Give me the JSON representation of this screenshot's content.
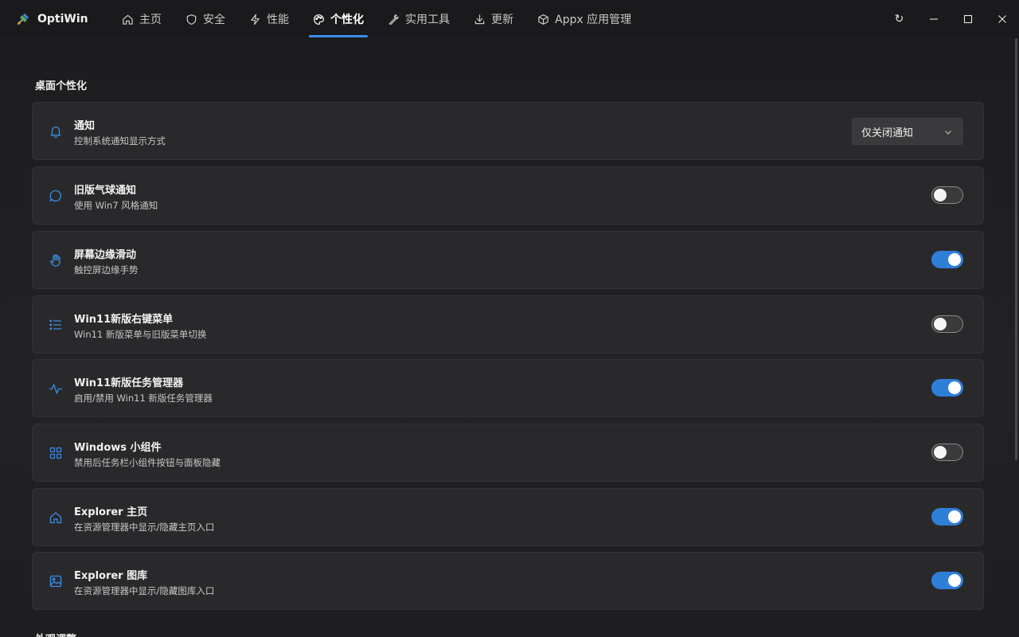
{
  "app": {
    "title": "OptiWin"
  },
  "tabs": [
    {
      "label": "主页",
      "icon": "home-icon"
    },
    {
      "label": "安全",
      "icon": "shield-icon"
    },
    {
      "label": "性能",
      "icon": "lightning-icon"
    },
    {
      "label": "个性化",
      "icon": "palette-icon",
      "active": true
    },
    {
      "label": "实用工具",
      "icon": "wrench-icon"
    },
    {
      "label": "更新",
      "icon": "download-icon"
    },
    {
      "label": "Appx 应用管理",
      "icon": "package-icon"
    }
  ],
  "window_controls": {
    "refresh": "↻"
  },
  "section": {
    "title": "桌面个性化",
    "next_title": "外观调整"
  },
  "settings": [
    {
      "title": "通知",
      "desc": "控制系统通知显示方式",
      "icon": "bell-icon",
      "control": "dropdown",
      "value": "仅关闭通知"
    },
    {
      "title": "旧版气球通知",
      "desc": "使用 Win7 风格通知",
      "icon": "chat-bubble-icon",
      "control": "toggle",
      "on": false
    },
    {
      "title": "屏幕边缘滑动",
      "desc": "触控屏边缘手势",
      "icon": "hand-icon",
      "control": "toggle",
      "on": true
    },
    {
      "title": "Win11新版右键菜单",
      "desc": "Win11 新版菜单与旧版菜单切换",
      "icon": "list-icon",
      "control": "toggle",
      "on": false
    },
    {
      "title": "Win11新版任务管理器",
      "desc": "启用/禁用 Win11 新版任务管理器",
      "icon": "activity-icon",
      "control": "toggle",
      "on": true
    },
    {
      "title": "Windows 小组件",
      "desc": "禁用后任务栏小组件按钮与面板隐藏",
      "icon": "grid-icon",
      "control": "toggle",
      "on": false
    },
    {
      "title": "Explorer 主页",
      "desc": "在资源管理器中显示/隐藏主页入口",
      "icon": "home-icon",
      "control": "toggle",
      "on": true
    },
    {
      "title": "Explorer 图库",
      "desc": "在资源管理器中显示/隐藏图库入口",
      "icon": "image-icon",
      "control": "toggle",
      "on": true
    }
  ],
  "colors": {
    "accent": "#2e7fd6",
    "icon": "#3b8de3",
    "card": "#29292c",
    "background": "#1f1f21"
  }
}
